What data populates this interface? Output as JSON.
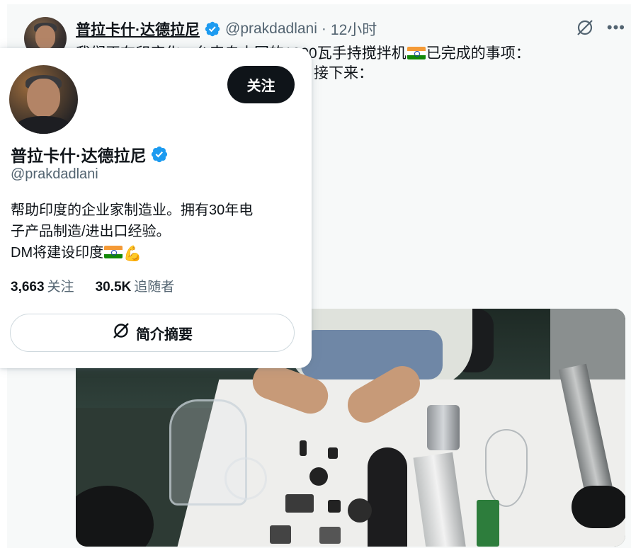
{
  "tweet": {
    "author_name": "普拉卡什·达德拉尼",
    "handle": "@prakdadlani",
    "separator": "·",
    "time": "12小时",
    "text_line1_pre": "我们正在印度化一台来自中国的1000瓦手持搅拌机",
    "text_line1_post": "已完成的事项：",
    "text_line2": "接下来："
  },
  "hover_card": {
    "follow_label": "关注",
    "name": "普拉卡什·达德拉尼",
    "handle": "@prakdadlani",
    "bio_line1": "帮助印度的企业家制造业。拥有30年电",
    "bio_line2": "子产品制造/进出口经验。",
    "bio_line3": "DM将建设印度",
    "following_count": "3,663",
    "following_label": "关注",
    "followers_count": "30.5K",
    "followers_label": "追随者",
    "summary_label": "简介摘要"
  },
  "icons": {
    "verified": "verified-badge-icon",
    "grok": "grok-icon",
    "more": "more-icon",
    "flag": "india-flag-icon",
    "flexed_biceps": "flexed-biceps-icon"
  },
  "colors": {
    "verified_blue": "#1d9bf0",
    "follow_button_bg": "#0f1419",
    "secondary_text": "#536471"
  }
}
